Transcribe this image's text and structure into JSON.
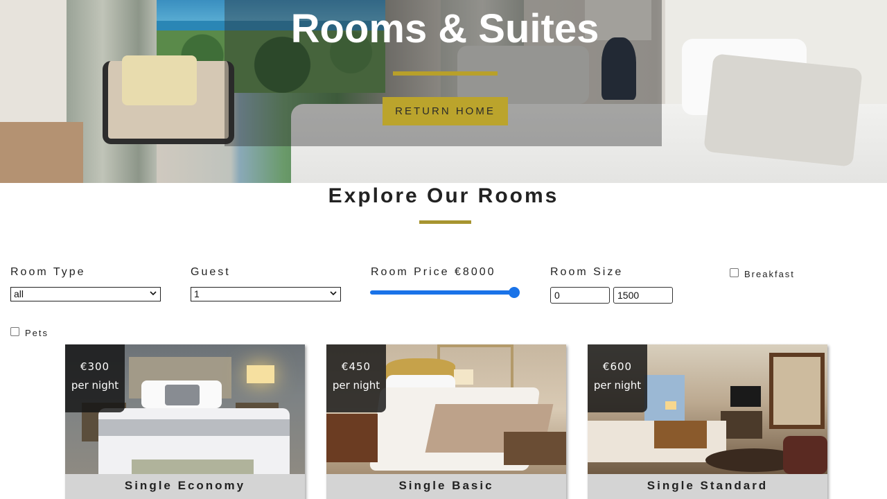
{
  "hero": {
    "title": "Rooms & Suites",
    "button_label": "Return Home",
    "accent_color": "#b8a02a"
  },
  "section": {
    "title": "Explore Our Rooms"
  },
  "filters": {
    "room_type": {
      "label": "Room Type",
      "value": "all"
    },
    "guest": {
      "label": "Guest",
      "value": "1"
    },
    "price": {
      "label": "Room Price €8000",
      "value": 8000,
      "slider_fraction": 1.0
    },
    "size": {
      "label": "Room Size",
      "min_value": "0",
      "max_value": "1500"
    },
    "breakfast": {
      "label": "Breakfast",
      "checked": false
    },
    "pets": {
      "label": "Pets",
      "checked": false
    }
  },
  "rooms": [
    {
      "name": "Single Economy",
      "price": "€300",
      "per": "per night"
    },
    {
      "name": "Single Basic",
      "price": "€450",
      "per": "per night"
    },
    {
      "name": "Single Standard",
      "price": "€600",
      "per": "per night"
    }
  ]
}
